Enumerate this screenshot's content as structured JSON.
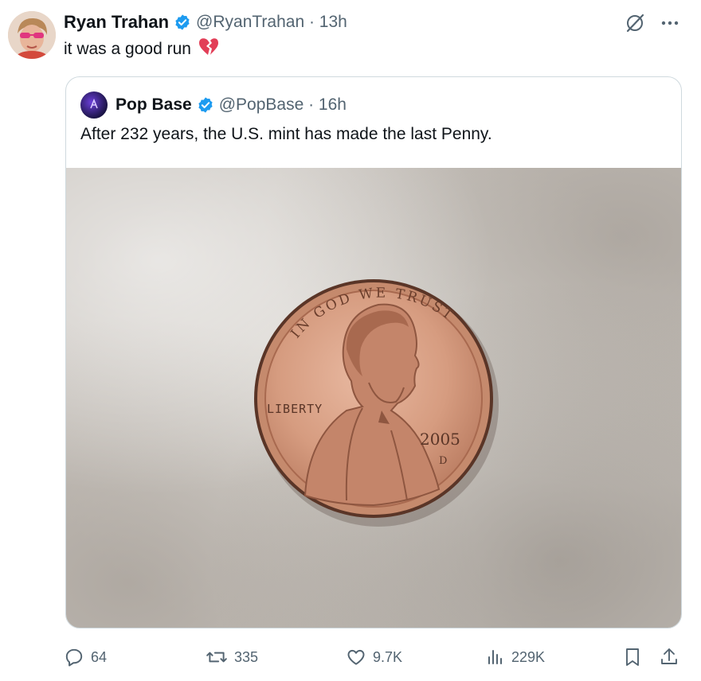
{
  "post": {
    "author_name": "Ryan Trahan",
    "handle_time": "@RyanTrahan · 13h",
    "text": "it was a good run"
  },
  "quoted_post": {
    "author_name": "Pop Base",
    "handle_time": "@PopBase · 16h",
    "text": "After 232 years, the U.S. mint has made the last Penny.",
    "media": {
      "coin_motto": "IN GOD WE TRUST",
      "coin_liberty": "LIBERTY",
      "coin_year": "2005",
      "coin_mint": "D"
    }
  },
  "actions": {
    "replies": "64",
    "reposts": "335",
    "likes": "9.7K",
    "views": "229K"
  },
  "colors": {
    "verified": "#1d9bf0",
    "secondary_text": "#536471",
    "border": "#cfd9de",
    "copper": "#c98c6f"
  }
}
